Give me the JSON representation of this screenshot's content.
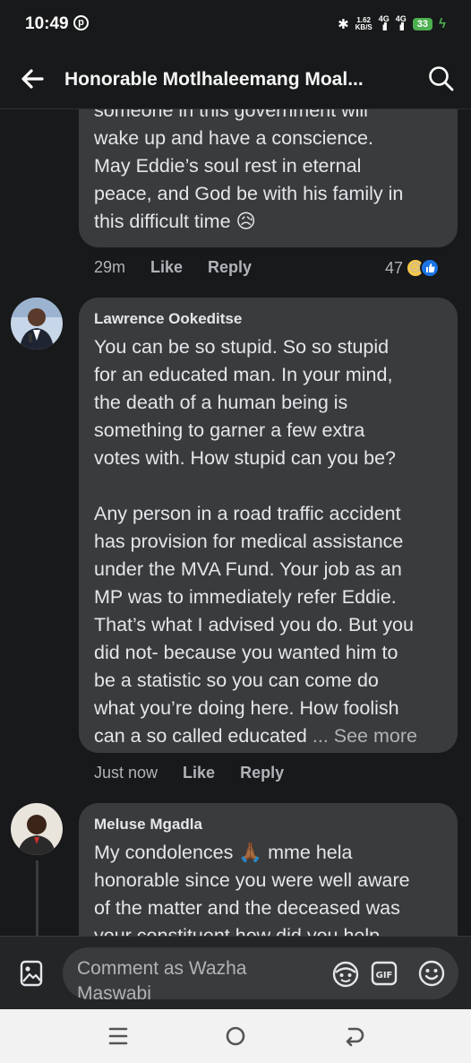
{
  "status_bar": {
    "time": "10:49",
    "notification_icon": "p-circle-icon",
    "bluetooth": "bluetooth-icon",
    "net_speed_value": "1.62",
    "net_speed_unit": "KB/S",
    "signal1_label": "4G",
    "signal2_label": "4G",
    "battery": "33",
    "charging_icon": "bolt-icon"
  },
  "header": {
    "title": "Honorable Motlhaleemang Moal...",
    "back_icon": "back-arrow-icon",
    "search_icon": "search-icon"
  },
  "comments": [
    {
      "text": "someone in this government will\nwake up and have a conscience.\nMay Eddie’s soul rest in eternal\npeace, and God be with his family in\nthis difficult time 😥",
      "time": "29m",
      "like_label": "Like",
      "reply_label": "Reply",
      "reaction_count": "47"
    },
    {
      "author": "Lawrence Ookeditse",
      "text": "You can be so stupid. So so stupid\nfor an educated man. In your mind,\nthe death of a human being is\nsomething to garner a few extra\nvotes with. How stupid can you be?\n\nAny person in a road traffic accident\nhas provision for medical assistance\nunder the MVA Fund. Your job as an\nMP was to immediately refer Eddie.\nThat’s what I advised you do. But you\ndid not- because you wanted him to\nbe a statistic so you can come do\nwhat you’re doing here. How foolish\ncan a so called educated ",
      "ellipsis": "...",
      "see_more": "See more",
      "time": "Just now",
      "like_label": "Like",
      "reply_label": "Reply"
    },
    {
      "author": "Meluse Mgadla",
      "text": "My condolences 🙏🏾 mme hela\nhonorable since you were well aware\nof the matter and the deceased was\nyour constituent how did you help"
    }
  ],
  "comment_bar": {
    "placeholder": "Comment as Wazha Maswabi",
    "photo_icon": "image-icon",
    "avatar_icon": "avatar-sticker-icon",
    "gif_icon": "gif-icon",
    "emoji_icon": "emoji-icon"
  },
  "nav_bar": {
    "recents_icon": "recents-icon",
    "home_icon": "home-icon",
    "back_icon": "nav-back-icon"
  },
  "colors": {
    "background": "#18191a",
    "bubble": "#3a3b3c",
    "text_primary": "#e4e6eb",
    "text_secondary": "#b0b3b8",
    "like_blue": "#1b74e4",
    "battery_green": "#4caf50"
  }
}
